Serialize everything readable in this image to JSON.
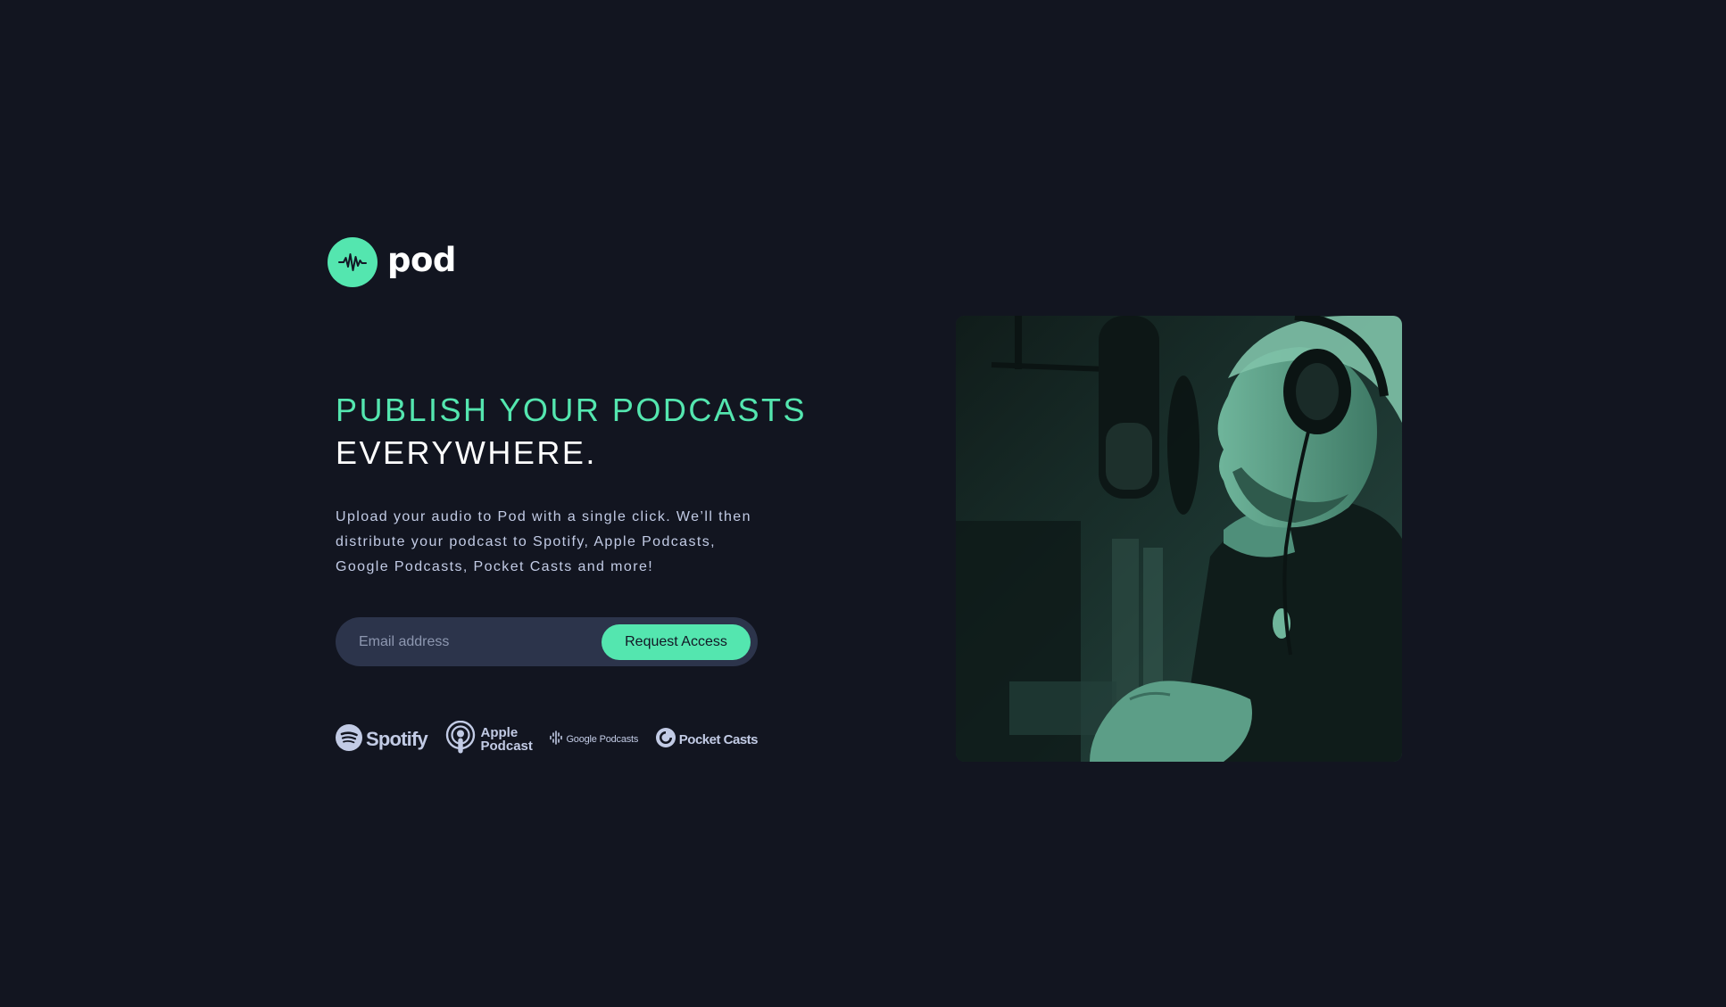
{
  "brand": {
    "name": "pod",
    "logo_icon": "waveform-icon",
    "accent_color": "#54e6af",
    "background_color": "#121520"
  },
  "hero": {
    "headline_line_1": "PUBLISH YOUR PODCASTS",
    "headline_line_2": "EVERYWHERE.",
    "description": "Upload your audio to Pod with a single click. We’ll then distribute your podcast to Spotify, Apple Podcasts, Google Podcasts, Pocket Casts and more!"
  },
  "form": {
    "email_placeholder": "Email address",
    "email_value": "",
    "submit_label": "Request Access"
  },
  "platforms": [
    {
      "name": "Spotify",
      "icon": "spotify-icon"
    },
    {
      "name_line_1": "Apple",
      "name_line_2": "Podcast",
      "icon": "apple-podcasts-icon"
    },
    {
      "name": "Google Podcasts",
      "icon": "google-podcasts-icon"
    },
    {
      "name": "Pocket Casts",
      "icon": "pocket-casts-icon"
    }
  ],
  "image": {
    "subject": "man-with-headphones-at-microphone",
    "tint_color": "#54e6af"
  }
}
